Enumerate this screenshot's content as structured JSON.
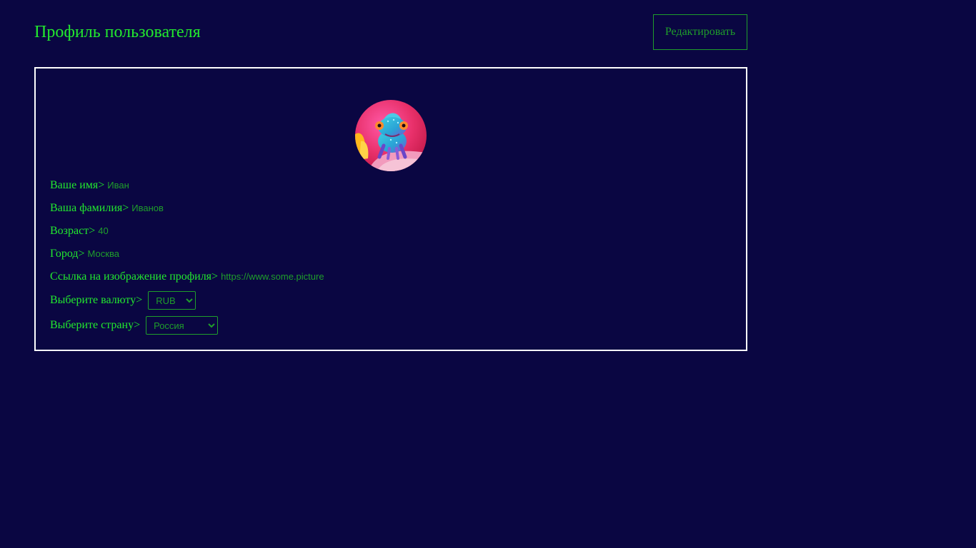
{
  "header": {
    "title": "Профиль пользователя",
    "edit_label": "Редактировать"
  },
  "colors": {
    "background": "#0a0642",
    "accent": "#22e82e",
    "accent_dim": "#1f9e2b",
    "card_border": "#ffffff"
  },
  "profile": {
    "avatar_icon": "chameleon-avatar",
    "fields": {
      "first_name": {
        "label": "Ваше имя>",
        "value": "Иван"
      },
      "last_name": {
        "label": "Ваша фамилия>",
        "value": "Иванов"
      },
      "age": {
        "label": "Возраст>",
        "value": "40"
      },
      "city": {
        "label": "Город>",
        "value": "Москва"
      },
      "avatar_url": {
        "label": "Ссылка на изображение профиля>",
        "value": "https://www.some.picture"
      },
      "currency": {
        "label": "Выберите валюту>",
        "selected": "RUB"
      },
      "country": {
        "label": "Выберите страну>",
        "selected": "Россия"
      }
    }
  }
}
